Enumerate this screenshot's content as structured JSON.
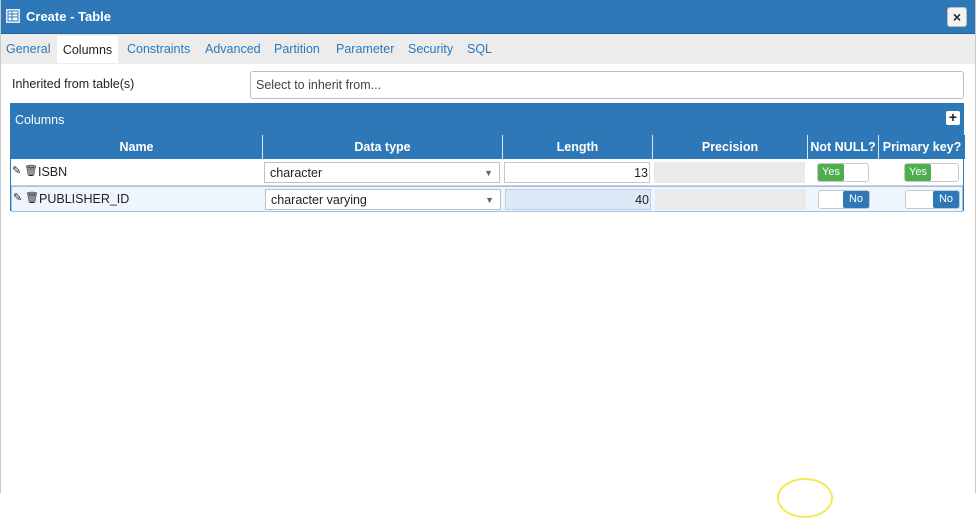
{
  "window": {
    "title": "Create - Table",
    "close_label": "×"
  },
  "tabs": [
    {
      "label": "General"
    },
    {
      "label": "Columns",
      "active": true
    },
    {
      "label": "Constraints"
    },
    {
      "label": "Advanced"
    },
    {
      "label": "Partition"
    },
    {
      "label": "Parameter"
    },
    {
      "label": "Security"
    },
    {
      "label": "SQL"
    }
  ],
  "inherit": {
    "label": "Inherited from table(s)",
    "placeholder": "Select to inherit from..."
  },
  "columns_panel": {
    "title": "Columns",
    "add_label": "+",
    "headers": [
      "Name",
      "Data type",
      "Length",
      "Precision",
      "Not NULL?",
      "Primary key?"
    ],
    "rows": [
      {
        "name": "ISBN",
        "data_type": "character",
        "length": "13",
        "precision": "",
        "not_null": "Yes",
        "primary_key": "Yes"
      },
      {
        "name": "PUBLISHER_ID",
        "data_type": "character varying",
        "length": "40",
        "precision": "",
        "not_null": "No",
        "primary_key": "No"
      }
    ]
  },
  "colors": {
    "titlebar": "#2e78b7",
    "toggle_yes": "#4cae4c",
    "toggle_no": "#2e78b7"
  },
  "icons": {
    "table": "table-icon",
    "edit": "edit-icon",
    "delete": "trash-icon",
    "dropdown": "chevron-down-icon"
  }
}
